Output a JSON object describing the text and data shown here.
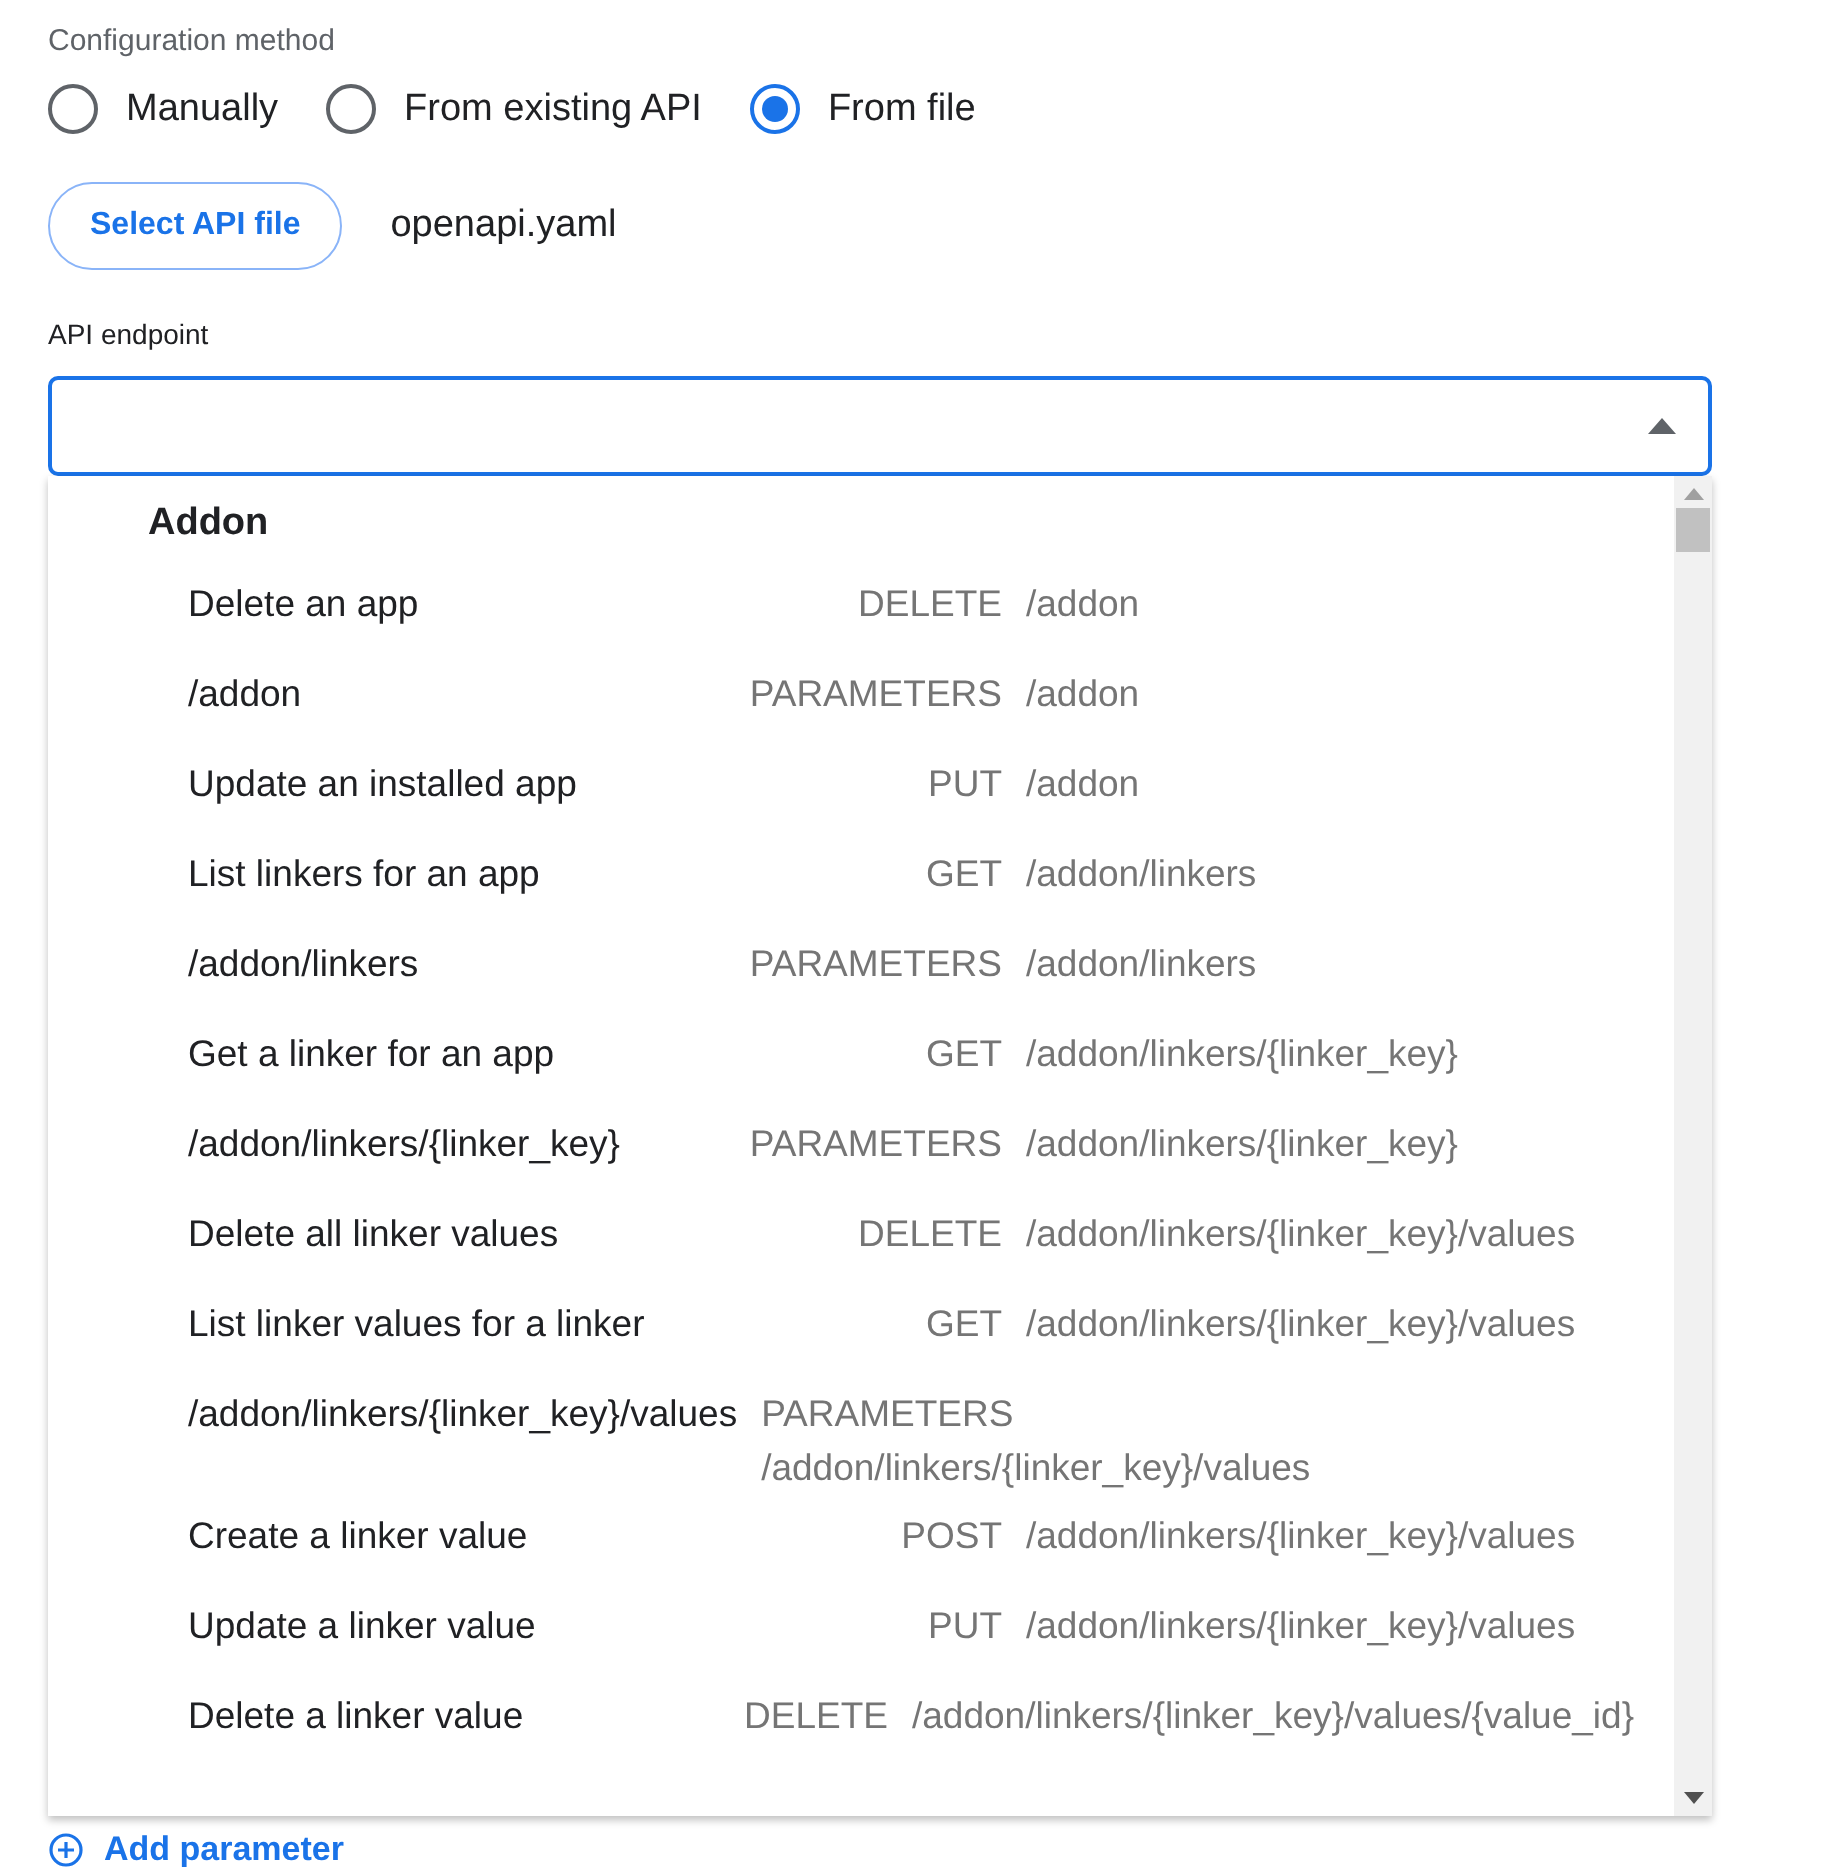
{
  "config_method": {
    "label": "Configuration method",
    "options": [
      {
        "label": "Manually",
        "selected": false
      },
      {
        "label": "From existing API",
        "selected": false
      },
      {
        "label": "From file",
        "selected": true
      }
    ]
  },
  "file": {
    "button": "Select API file",
    "filename": "openapi.yaml"
  },
  "endpoint": {
    "label": "API endpoint",
    "expanded": true,
    "groups": [
      {
        "title": "Addon",
        "items": [
          {
            "name": "Delete an app",
            "method": "DELETE",
            "path": "/addon"
          },
          {
            "name": "/addon",
            "method": "PARAMETERS",
            "path": "/addon"
          },
          {
            "name": "Update an installed app",
            "method": "PUT",
            "path": "/addon"
          },
          {
            "name": "List linkers for an app",
            "method": "GET",
            "path": "/addon/linkers"
          },
          {
            "name": "/addon/linkers",
            "method": "PARAMETERS",
            "path": "/addon/linkers"
          },
          {
            "name": "Get a linker for an app",
            "method": "GET",
            "path": "/addon/linkers/{linker_key}"
          },
          {
            "name": "/addon/linkers/{linker_key}",
            "method": "PARAMETERS",
            "path": "/addon/linkers/{linker_key}"
          },
          {
            "name": "Delete all linker values",
            "method": "DELETE",
            "path": "/addon/linkers/{linker_key}/values"
          },
          {
            "name": "List linker values for a linker",
            "method": "GET",
            "path": "/addon/linkers/{linker_key}/values"
          },
          {
            "name": "/addon/linkers/{linker_key}/values",
            "method": "PARAMETERS",
            "path": "/addon/linkers/{linker_key}/values"
          },
          {
            "name": "Create a linker value",
            "method": "POST",
            "path": "/addon/linkers/{linker_key}/values"
          },
          {
            "name": "Update a linker value",
            "method": "PUT",
            "path": "/addon/linkers/{linker_key}/values"
          },
          {
            "name": "Delete a linker value",
            "method": "DELETE",
            "path": "/addon/linkers/{linker_key}/values/{value_id}"
          }
        ]
      }
    ]
  },
  "add_parameter": "Add parameter"
}
